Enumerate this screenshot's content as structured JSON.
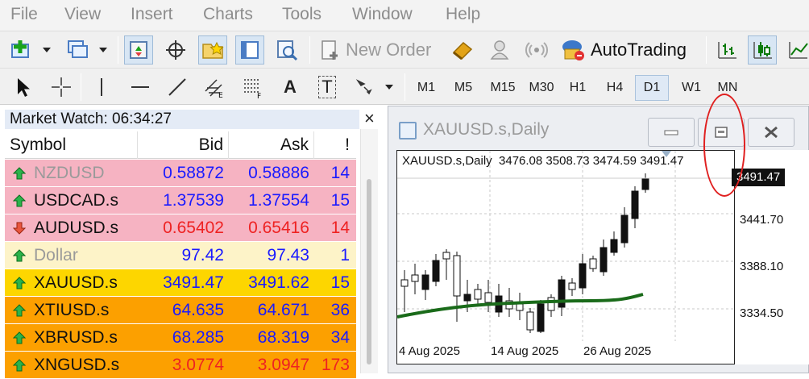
{
  "menu": [
    "File",
    "View",
    "Insert",
    "Charts",
    "Tools",
    "Window",
    "Help"
  ],
  "toolbar": {
    "new_order_label": "New Order",
    "autotrading_label": "AutoTrading",
    "icons": [
      "new-chart-icon",
      "profiles-icon",
      "market-watch-icon",
      "data-window-icon",
      "navigator-icon",
      "terminal-icon",
      "strategy-tester-icon",
      "new-order-icon",
      "metaeditor-icon",
      "signals-icon",
      "radio-icon",
      "autotrading-icon",
      "bar-chart-icon",
      "candlestick-icon",
      "line-chart-icon"
    ]
  },
  "tools": {
    "text_label": "A",
    "text_label_tool": "T"
  },
  "timeframes": [
    "M1",
    "M5",
    "M15",
    "M30",
    "H1",
    "H4",
    "D1",
    "W1",
    "MN"
  ],
  "active_timeframe": "D1",
  "market_watch": {
    "title": "Market Watch: 06:34:27",
    "close_label": "×",
    "columns": [
      "Symbol",
      "Bid",
      "Ask",
      "!"
    ],
    "rows": [
      {
        "symbol": "NZDUSD",
        "bid": "0.58872",
        "ask": "0.58886",
        "spread": "14",
        "direction": "up",
        "bg": "#f6b3c2",
        "symbol_color": "#9a9a9a",
        "price_color": "#1a1aff"
      },
      {
        "symbol": "USDCAD.s",
        "bid": "1.37539",
        "ask": "1.37554",
        "spread": "15",
        "direction": "up",
        "bg": "#f6b3c2",
        "symbol_color": "#111111",
        "price_color": "#1a1aff"
      },
      {
        "symbol": "AUDUSD.s",
        "bid": "0.65402",
        "ask": "0.65416",
        "spread": "14",
        "direction": "down",
        "bg": "#f6b3c2",
        "symbol_color": "#111111",
        "price_color": "#ee2222"
      },
      {
        "symbol": "Dollar",
        "bid": "97.42",
        "ask": "97.43",
        "spread": "1",
        "direction": "up",
        "bg": "#fdf3c8",
        "symbol_color": "#9a9a9a",
        "price_color": "#1a1aff"
      },
      {
        "symbol": "XAUUSD.s",
        "bid": "3491.47",
        "ask": "3491.62",
        "spread": "15",
        "direction": "up",
        "bg": "#fdd600",
        "symbol_color": "#111111",
        "price_color": "#1a1aff"
      },
      {
        "symbol": "XTIUSD.s",
        "bid": "64.635",
        "ask": "64.671",
        "spread": "36",
        "direction": "up",
        "bg": "#fca000",
        "symbol_color": "#111111",
        "price_color": "#1a1aff"
      },
      {
        "symbol": "XBRUSD.s",
        "bid": "68.285",
        "ask": "68.319",
        "spread": "34",
        "direction": "up",
        "bg": "#fca000",
        "symbol_color": "#111111",
        "price_color": "#1a1aff"
      },
      {
        "symbol": "XNGUSD.s",
        "bid": "3.0774",
        "ask": "3.0947",
        "spread": "173",
        "direction": "up",
        "bg": "#fca000",
        "symbol_color": "#111111",
        "price_color": "#ee2222"
      }
    ]
  },
  "chart_window": {
    "title": "XAUUSD.s,Daily",
    "info": "XAUUSD.s,Daily  3476.08 3508.73 3474.59 3491.47",
    "current_price": "3491.47",
    "price_labels": [
      "3441.70",
      "3388.10",
      "3334.50"
    ],
    "date_labels": [
      "4 Aug 2025",
      "14 Aug 2025",
      "26 Aug 2025"
    ],
    "ma_color": "#1a6b1a"
  }
}
